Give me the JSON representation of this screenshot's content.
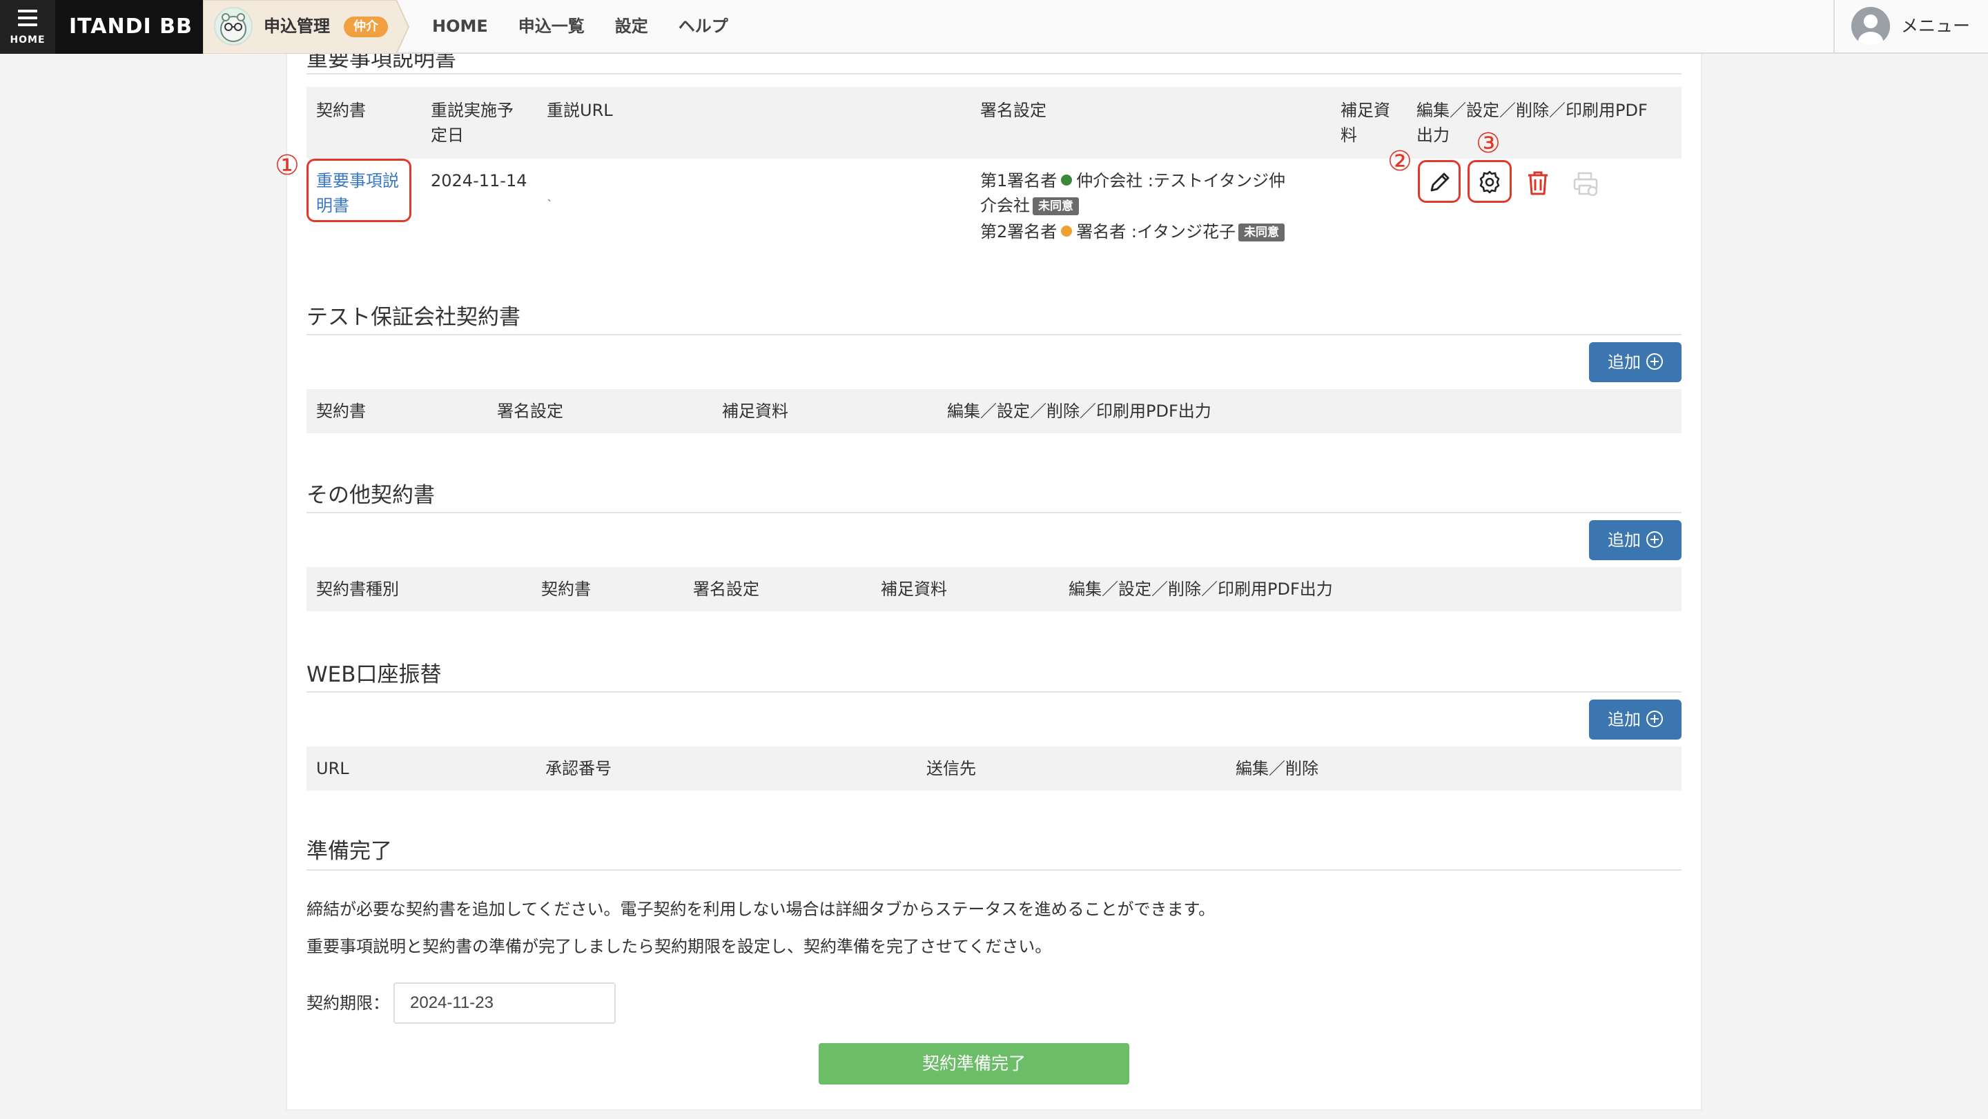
{
  "header": {
    "home_label": "HOME",
    "brand": "ITANDI BB",
    "app_name": "申込管理",
    "app_badge": "仲介",
    "nav": [
      "HOME",
      "申込一覧",
      "設定",
      "ヘルプ"
    ],
    "menu_label": "メニュー"
  },
  "important": {
    "title": "重要事項説明書",
    "columns": [
      "契約書",
      "重説実施予\n定日",
      "重説URL",
      "署名設定",
      "補足資\n料",
      "編集／設定／削除／印刷用PDF\n出力"
    ],
    "row": {
      "doc_link": "重要事項説\n明書",
      "date": "2024-11-14",
      "url": "`",
      "signer1_prefix": "第1署名者",
      "signer1_role": "仲介会社",
      "signer1_name": ":テストイタンジ仲\n介会社",
      "signer1_status": "未同意",
      "signer2_prefix": "第2署名者",
      "signer2_role": "署名者",
      "signer2_name": ":イタンジ花子",
      "signer2_status": "未同意"
    },
    "markers": [
      "①",
      "②",
      "③"
    ],
    "colors": {
      "signer1_dot": "#3a8a3a",
      "signer2_dot": "#f0a030",
      "delete": "#d9372b"
    }
  },
  "guarantee": {
    "title": "テスト保証会社契約書",
    "add_label": "追加",
    "columns": [
      "契約書",
      "署名設定",
      "補足資料",
      "編集／設定／削除／印刷用PDF出力"
    ]
  },
  "other": {
    "title": "その他契約書",
    "add_label": "追加",
    "columns": [
      "契約書種別",
      "契約書",
      "署名設定",
      "補足資料",
      "編集／設定／削除／印刷用PDF出力"
    ]
  },
  "web": {
    "title": "WEB口座振替",
    "add_label": "追加",
    "columns": [
      "URL",
      "承認番号",
      "送信先",
      "編集／削除"
    ]
  },
  "ready": {
    "title": "準備完了",
    "line1": "締結が必要な契約書を追加してください。電子契約を利用しない場合は詳細タブからステータスを進めることができます。",
    "line2": "重要事項説明と契約書の準備が完了しましたら契約期限を設定し、契約準備を完了させてください。",
    "deadline_label": "契約期限：",
    "deadline_value": "2024-11-23",
    "complete_button": "契約準備完了"
  }
}
